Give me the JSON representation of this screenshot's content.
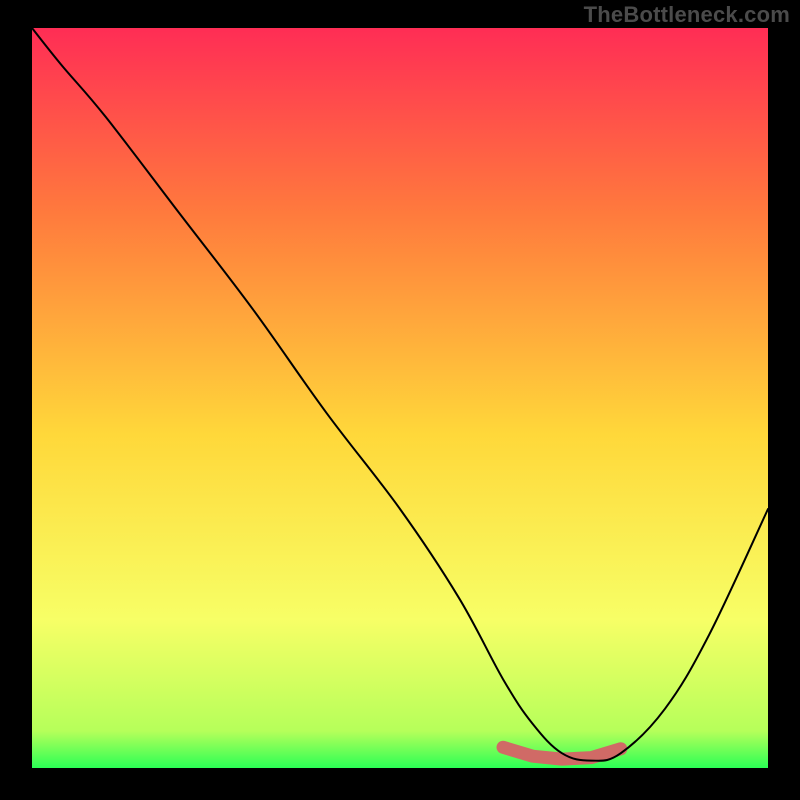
{
  "watermark": "TheBottleneck.com",
  "chart_data": {
    "type": "line",
    "title": "",
    "xlabel": "",
    "ylabel": "",
    "xlim": [
      0,
      100
    ],
    "ylim": [
      0,
      100
    ],
    "grid": false,
    "legend": false,
    "gradient_stops": [
      {
        "offset": 0,
        "color": "#ff2d55"
      },
      {
        "offset": 25,
        "color": "#ff7a3d"
      },
      {
        "offset": 55,
        "color": "#ffd83a"
      },
      {
        "offset": 80,
        "color": "#f7ff66"
      },
      {
        "offset": 95,
        "color": "#b6ff5a"
      },
      {
        "offset": 100,
        "color": "#2bff55"
      }
    ],
    "series": [
      {
        "name": "bottleneck-curve",
        "x": [
          0,
          4,
          10,
          20,
          30,
          40,
          50,
          58,
          64,
          68,
          72,
          76,
          80,
          86,
          92,
          100
        ],
        "values": [
          100,
          95,
          88,
          75,
          62,
          48,
          35,
          23,
          12,
          6,
          2,
          1,
          2,
          8,
          18,
          35
        ]
      }
    ],
    "trough_highlight": {
      "x": [
        64,
        68,
        72,
        76,
        80
      ],
      "values": [
        2.8,
        1.6,
        1.2,
        1.4,
        2.6
      ]
    }
  }
}
